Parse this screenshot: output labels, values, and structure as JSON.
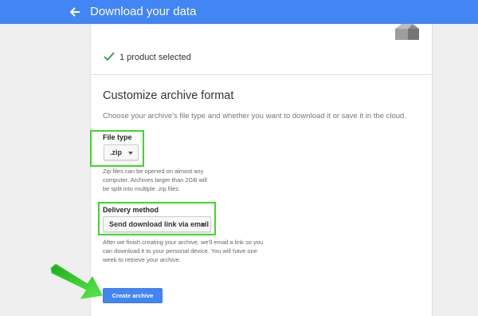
{
  "header": {
    "title": "Download your data",
    "color": "#4285f4"
  },
  "selection": {
    "text": "1 product selected"
  },
  "section": {
    "title": "Customize archive format",
    "description": "Choose your archive's file type and whether you want to download it or save it in the cloud."
  },
  "file_type": {
    "label": "File type",
    "selected": ".zip",
    "help": "Zip files can be opened on almost any computer. Archives larger than 2GB will be split into multiple .zip files."
  },
  "delivery_method": {
    "label": "Delivery method",
    "selected": "Send download link via email",
    "help": "After we finish creating your archive, we'll email a link so you can download it to your personal device. You will have one week to retrieve your archive."
  },
  "actions": {
    "create_label": "Create archive"
  },
  "annotations": {
    "highlight_color": "#3fd52c"
  },
  "icons": [
    "back-arrow-icon",
    "archive-box-icon",
    "checkmark-icon",
    "caret-down-icon",
    "pointer-arrow-icon"
  ]
}
